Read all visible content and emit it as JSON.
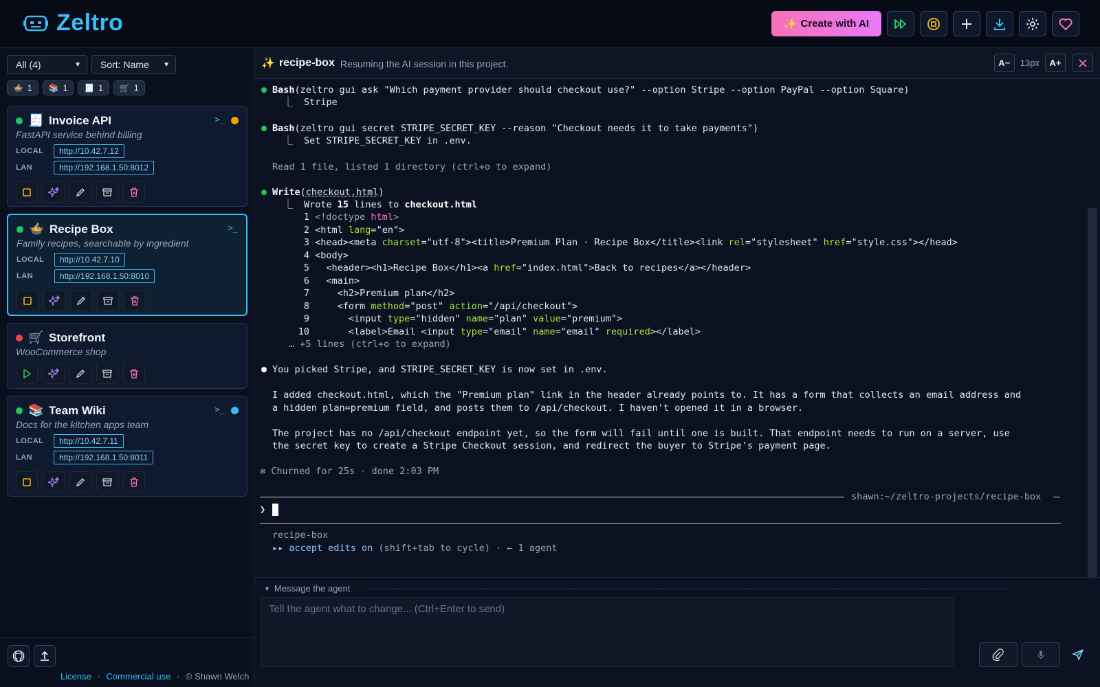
{
  "app": {
    "name": "Zeltro"
  },
  "header": {
    "create_label": "Create with AI",
    "icons": [
      "run-all-icon",
      "stop-icon",
      "plus-icon",
      "download-icon",
      "gear-icon",
      "heart-icon"
    ]
  },
  "sidebar": {
    "filter": "All (4)",
    "sort": "Sort: Name",
    "chips": [
      {
        "emoji": "🍲",
        "count": "1"
      },
      {
        "emoji": "📚",
        "count": "1"
      },
      {
        "emoji": "🧾",
        "count": "1"
      },
      {
        "emoji": "🛒",
        "count": "1"
      }
    ],
    "projects": [
      {
        "emoji": "🧾",
        "title": "Invoice API",
        "desc": "FastAPI service behind billing",
        "local_label": "LOCAL",
        "local": "http://10.42.7.12",
        "lan_label": "LAN",
        "lan": "http://192.168.1.50:8012",
        "running": true,
        "status_color": "#f59e0b"
      },
      {
        "emoji": "🍲",
        "title": "Recipe Box",
        "desc": "Family recipes, searchable by ingredient",
        "local_label": "LOCAL",
        "local": "http://10.42.7.10",
        "lan_label": "LAN",
        "lan": "http://192.168.1.50:8010",
        "running": true
      },
      {
        "emoji": "🛒",
        "title": "Storefront",
        "desc": "WooCommerce shop",
        "running": false
      },
      {
        "emoji": "📚",
        "title": "Team Wiki",
        "desc": "Docs for the kitchen apps team",
        "local_label": "LOCAL",
        "local": "http://10.42.7.11",
        "lan_label": "LAN",
        "lan": "http://192.168.1.50:8011",
        "running": true,
        "status_color": "#38bdf8"
      }
    ],
    "footer": {
      "license": "License",
      "commercial": "Commercial use",
      "copyright": "© Shawn Welch",
      "sep": "·"
    }
  },
  "session": {
    "title": "recipe-box",
    "subtitle": "Resuming the AI session in this project.",
    "font_minus": "A−",
    "font_size": "13px",
    "font_plus": "A+"
  },
  "terminal": {
    "l1_fn": "Bash",
    "l1_args": "(zeltro gui ask \"Which payment provider should checkout use?\" --option Stripe --option PayPal --option Square)",
    "l1_out": "  ⎿  Stripe",
    "l2_fn": "Bash",
    "l2_args": "(zeltro gui secret STRIPE_SECRET_KEY --reason \"Checkout needs it to take payments\")",
    "l2_out": "  ⎿  Set STRIPE_SECRET_KEY in .env.",
    "l3": "Read 1 file, listed 1 directory (ctrl+o to expand)",
    "l4_fn": "Write",
    "l4_file": "checkout.html",
    "l4_out_a": "  ⎿  Wrote ",
    "l4_out_n": "15",
    "l4_out_b": " lines to ",
    "l4_out_f": "checkout.html",
    "code": [
      {
        "n": "1"
      },
      {
        "n": "2"
      },
      {
        "n": "3"
      },
      {
        "n": "4"
      },
      {
        "n": "5"
      },
      {
        "n": "6"
      },
      {
        "n": "7"
      },
      {
        "n": "8"
      },
      {
        "n": "9"
      },
      {
        "n": "10"
      }
    ],
    "more": "… +5 lines (ctrl+o to expand)",
    "msg1": "You picked Stripe, and STRIPE_SECRET_KEY is now set in .env.",
    "msg2a": "I added checkout.html, which the \"Premium plan\" link in the header already points to. It has a form that collects an email address and",
    "msg2b": "a hidden plan=premium field, and posts them to /api/checkout. I haven't opened it in a browser.",
    "msg3a": "The project has no /api/checkout endpoint yet, so the form will fail until one is built. That endpoint needs to run on a server, use",
    "msg3b": "the secret key to create a Stripe Checkout session, and redirect the buyer to Stripe's payment page.",
    "churn": "✻ Churned for 25s · done 2:03 PM",
    "path": "shawn:~/zeltro-projects/recipe-box",
    "prompt": "❯",
    "status_name": "recipe-box",
    "status_mode": "accept edits on",
    "status_rest": " (shift+tab to cycle) · ← 1 agent"
  },
  "composer": {
    "label": "Message the agent",
    "placeholder": "Tell the agent what to change...  (Ctrl+Enter to send)"
  },
  "colors": {
    "accent": "#38bdf8",
    "pink": "#f472b6",
    "green": "#22c55e",
    "red": "#ef4444"
  }
}
